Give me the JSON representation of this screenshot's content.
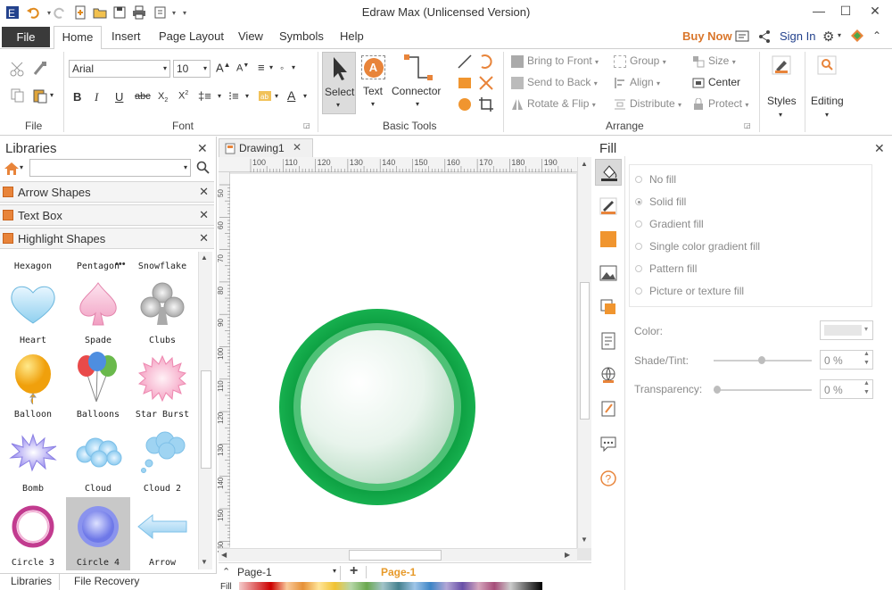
{
  "window": {
    "title": "Edraw Max (Unlicensed Version)"
  },
  "tabs": {
    "file": "File",
    "items": [
      "Home",
      "Insert",
      "Page Layout",
      "View",
      "Symbols",
      "Help"
    ],
    "buy_now": "Buy Now",
    "sign_in": "Sign In"
  },
  "ribbon": {
    "font": {
      "name": "Arial",
      "size": "10"
    },
    "groups": {
      "file": "File",
      "font": "Font",
      "basic_tools": "Basic Tools",
      "arrange": "Arrange"
    },
    "basic_tools": {
      "select": "Select",
      "text": "Text",
      "connector": "Connector"
    },
    "arrange": {
      "bring_to_front": "Bring to Front",
      "send_to_back": "Send to Back",
      "rotate_flip": "Rotate & Flip",
      "group": "Group",
      "align": "Align",
      "distribute": "Distribute",
      "size": "Size",
      "center": "Center",
      "protect": "Protect"
    },
    "styles": "Styles",
    "editing": "Editing"
  },
  "libraries": {
    "title": "Libraries",
    "search_placeholder": "",
    "sections": [
      "Arrow Shapes",
      "Text Box",
      "Highlight Shapes"
    ],
    "shapes": [
      "Hexagon",
      "Pentagon",
      "Snowflake",
      "Heart",
      "Spade",
      "Clubs",
      "Balloon",
      "Balloons",
      "Star Burst",
      "Bomb",
      "Cloud",
      "Cloud 2",
      "Circle 3",
      "Circle 4",
      "Arrow"
    ],
    "bottom_tabs": [
      "Libraries",
      "File Recovery"
    ]
  },
  "document": {
    "tab": "Drawing1",
    "ruler_top": [
      "100",
      "110",
      "120",
      "130",
      "140",
      "150",
      "160",
      "170",
      "180",
      "190"
    ],
    "ruler_left": [
      "50",
      "60",
      "70",
      "80",
      "90",
      "100",
      "110",
      "120",
      "130",
      "140",
      "150",
      "160"
    ],
    "page_selector": "Page-1",
    "active_page": "Page-1",
    "palette_label": "Fill"
  },
  "fill_panel": {
    "title": "Fill",
    "options": [
      "No fill",
      "Solid fill",
      "Gradient fill",
      "Single color gradient fill",
      "Pattern fill",
      "Picture or texture fill"
    ],
    "selected_option": "Solid fill",
    "color_label": "Color:",
    "shade_label": "Shade/Tint:",
    "shade_value": "0 %",
    "transparency_label": "Transparency:",
    "transparency_value": "0 %"
  },
  "colors": {
    "accent": "#c2541c",
    "buy_now": "#d9762b",
    "page_tab": "#e79a2a",
    "circle_green": "#1fa84a"
  }
}
